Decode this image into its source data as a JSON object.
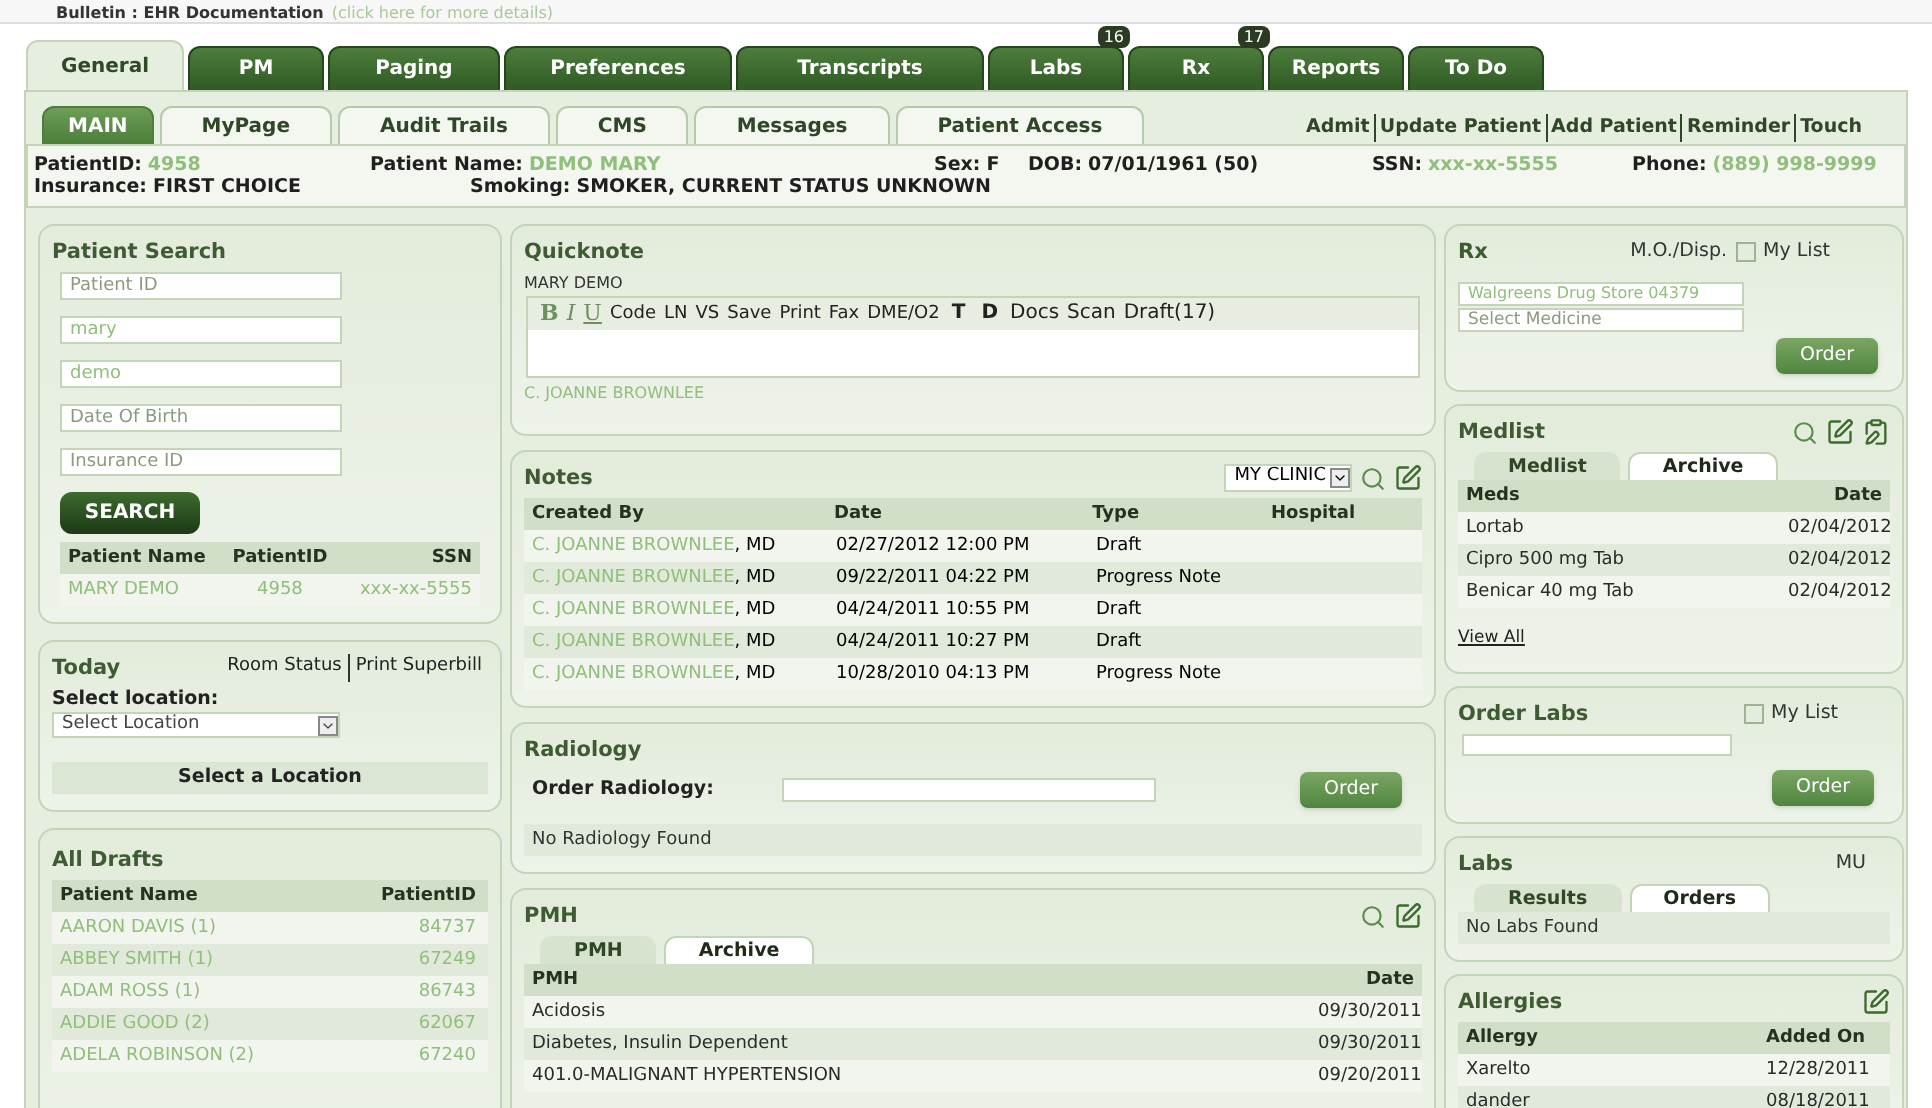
{
  "bulletin": {
    "label": "Bulletin : EHR Documentation",
    "link": "(click here for more details)"
  },
  "main_tabs": [
    {
      "label": "General",
      "selected": true
    },
    {
      "label": "PM",
      "selected": false
    },
    {
      "label": "Paging",
      "selected": false
    },
    {
      "label": "Preferences",
      "selected": false
    },
    {
      "label": "Transcripts",
      "selected": false
    },
    {
      "label": "Labs",
      "selected": false,
      "badge": "16"
    },
    {
      "label": "Rx",
      "selected": false,
      "badge": "17"
    },
    {
      "label": "Reports",
      "selected": false
    },
    {
      "label": "To Do",
      "selected": false
    }
  ],
  "sub_tabs": [
    {
      "label": "MAIN",
      "selected": true
    },
    {
      "label": "MyPage",
      "selected": false
    },
    {
      "label": "Audit Trails",
      "selected": false
    },
    {
      "label": "CMS",
      "selected": false
    },
    {
      "label": "Messages",
      "selected": false
    },
    {
      "label": "Patient Access",
      "selected": false
    }
  ],
  "actions": [
    "Admit",
    "Update Patient",
    "Add Patient",
    "Reminder",
    "Touch"
  ],
  "patient_info": [
    [
      {
        "label": "PatientID:",
        "value": "4958",
        "masked": true
      },
      {
        "label": "Patient Name:",
        "value": "DEMO MARY",
        "masked": true
      },
      {
        "label": "Sex:",
        "value": "F",
        "masked": false
      },
      {
        "label": "DOB:",
        "value": "07/01/1961 (50)",
        "masked": false
      },
      {
        "label": "SSN:",
        "value": "xxx-xx-5555",
        "masked": true
      },
      {
        "label": "Phone:",
        "value": "(889) 998-9999",
        "masked": true
      }
    ],
    [
      {
        "label": "Insurance:",
        "value": "FIRST CHOICE",
        "masked": false
      },
      {
        "label": "Smoking:",
        "value": "SMOKER, CURRENT STATUS UNKNOWN",
        "masked": false
      }
    ]
  ],
  "patient_search": {
    "title": "Patient Search",
    "fields": [
      {
        "placeholder": "Patient ID"
      },
      {
        "value": "mary"
      },
      {
        "value": "demo"
      },
      {
        "placeholder": "Date Of Birth"
      },
      {
        "placeholder": "Insurance ID"
      }
    ],
    "button": "SEARCH",
    "columns": [
      "Patient Name",
      "PatientID",
      "SSN"
    ],
    "rows": [
      [
        "MARY DEMO",
        "4958",
        "xxx-xx-5555"
      ]
    ]
  },
  "today": {
    "title": "Today",
    "links": [
      "Room Status",
      "Print Superbill"
    ],
    "location_label": "Select location:",
    "select": "Select Location",
    "message": "Select a Location"
  },
  "all_drafts": {
    "title": "All Drafts",
    "columns": [
      "Patient Name",
      "PatientID"
    ],
    "rows": [
      [
        "AARON DAVIS (1)",
        "84737"
      ],
      [
        "ABBEY SMITH (1)",
        "67249"
      ],
      [
        "ADAM ROSS (1)",
        "86743"
      ],
      [
        "ADDIE GOOD (2)",
        "62067"
      ],
      [
        "ADELA ROBINSON (2)",
        "67240"
      ]
    ]
  },
  "quicknote": {
    "title": "Quicknote",
    "patient": "MARY DEMO",
    "toolbar": [
      {
        "label": "B",
        "kind": "format"
      },
      {
        "label": "I",
        "kind": "format"
      },
      {
        "label": "U",
        "kind": "format"
      },
      {
        "label": "Code",
        "kind": "small"
      },
      {
        "label": "LN",
        "kind": "small"
      },
      {
        "label": "VS",
        "kind": "small"
      },
      {
        "label": "Save",
        "kind": "small"
      },
      {
        "label": "Print",
        "kind": "small"
      },
      {
        "label": "Fax",
        "kind": "small"
      },
      {
        "label": "DME/O2",
        "kind": "small"
      },
      {
        "label": "T",
        "kind": "bold"
      },
      {
        "label": "D",
        "kind": "bold"
      },
      {
        "label": "Docs",
        "kind": "plain"
      },
      {
        "label": "Scan",
        "kind": "plain"
      },
      {
        "label": "Draft(17)",
        "kind": "plain"
      }
    ],
    "signer": "C. JOANNE BROWNLEE"
  },
  "notes": {
    "title": "Notes",
    "filter": "MY CLINIC",
    "columns": [
      "Created By",
      "Date",
      "Type",
      "Hospital"
    ],
    "rows": [
      {
        "name": "C. JOANNE BROWNLEE",
        "credential": ", MD",
        "date": "02/27/2012 12:00 PM",
        "type": "Draft"
      },
      {
        "name": "C. JOANNE BROWNLEE",
        "credential": ", MD",
        "date": "09/22/2011 04:22 PM",
        "type": "Progress Note"
      },
      {
        "name": "C. JOANNE BROWNLEE",
        "credential": ", MD",
        "date": "04/24/2011 10:55 PM",
        "type": "Draft"
      },
      {
        "name": "C. JOANNE BROWNLEE",
        "credential": ", MD",
        "date": "04/24/2011 10:27 PM",
        "type": "Draft"
      },
      {
        "name": "C. JOANNE BROWNLEE",
        "credential": ", MD",
        "date": "10/28/2010 04:13 PM",
        "type": "Progress Note"
      }
    ]
  },
  "radiology": {
    "title": "Radiology",
    "label": "Order Radiology:",
    "button": "Order",
    "empty": "No Radiology Found"
  },
  "pmh": {
    "title": "PMH",
    "tabs": [
      {
        "label": "PMH",
        "selected": false
      },
      {
        "label": "Archive",
        "selected": true
      }
    ],
    "columns": [
      "PMH",
      "Date"
    ],
    "rows": [
      [
        "Acidosis",
        "09/30/2011"
      ],
      [
        "Diabetes, Insulin Dependent",
        "09/30/2011"
      ],
      [
        "401.0-MALIGNANT HYPERTENSION",
        "09/20/2011"
      ]
    ]
  },
  "rx": {
    "title": "Rx",
    "mo_label": "M.O./Disp.",
    "my_list": {
      "label": "My List",
      "checked": false
    },
    "pharmacy": "Walgreens Drug Store 04379",
    "medicine_placeholder": "Select Medicine",
    "button": "Order"
  },
  "medlist": {
    "title": "Medlist",
    "tabs": [
      {
        "label": "Medlist",
        "selected": false
      },
      {
        "label": "Archive",
        "selected": true
      }
    ],
    "columns": [
      "Meds",
      "Date"
    ],
    "rows": [
      [
        "Lortab",
        "02/04/2012"
      ],
      [
        "Cipro 500 mg Tab",
        "02/04/2012"
      ],
      [
        "Benicar 40 mg Tab",
        "02/04/2012"
      ]
    ],
    "view_all": "View All"
  },
  "order_labs": {
    "title": "Order Labs",
    "my_list": {
      "label": "My List",
      "checked": false
    },
    "button": "Order"
  },
  "labs": {
    "title": "Labs",
    "mu": "MU",
    "tabs": [
      {
        "label": "Results",
        "selected": false
      },
      {
        "label": "Orders",
        "selected": true
      }
    ],
    "empty": "No Labs Found"
  },
  "allergies": {
    "title": "Allergies",
    "columns": [
      "Allergy",
      "Added On"
    ],
    "rows": [
      [
        "Xarelto",
        "12/28/2011"
      ],
      [
        "dander",
        "08/18/2011"
      ]
    ]
  }
}
